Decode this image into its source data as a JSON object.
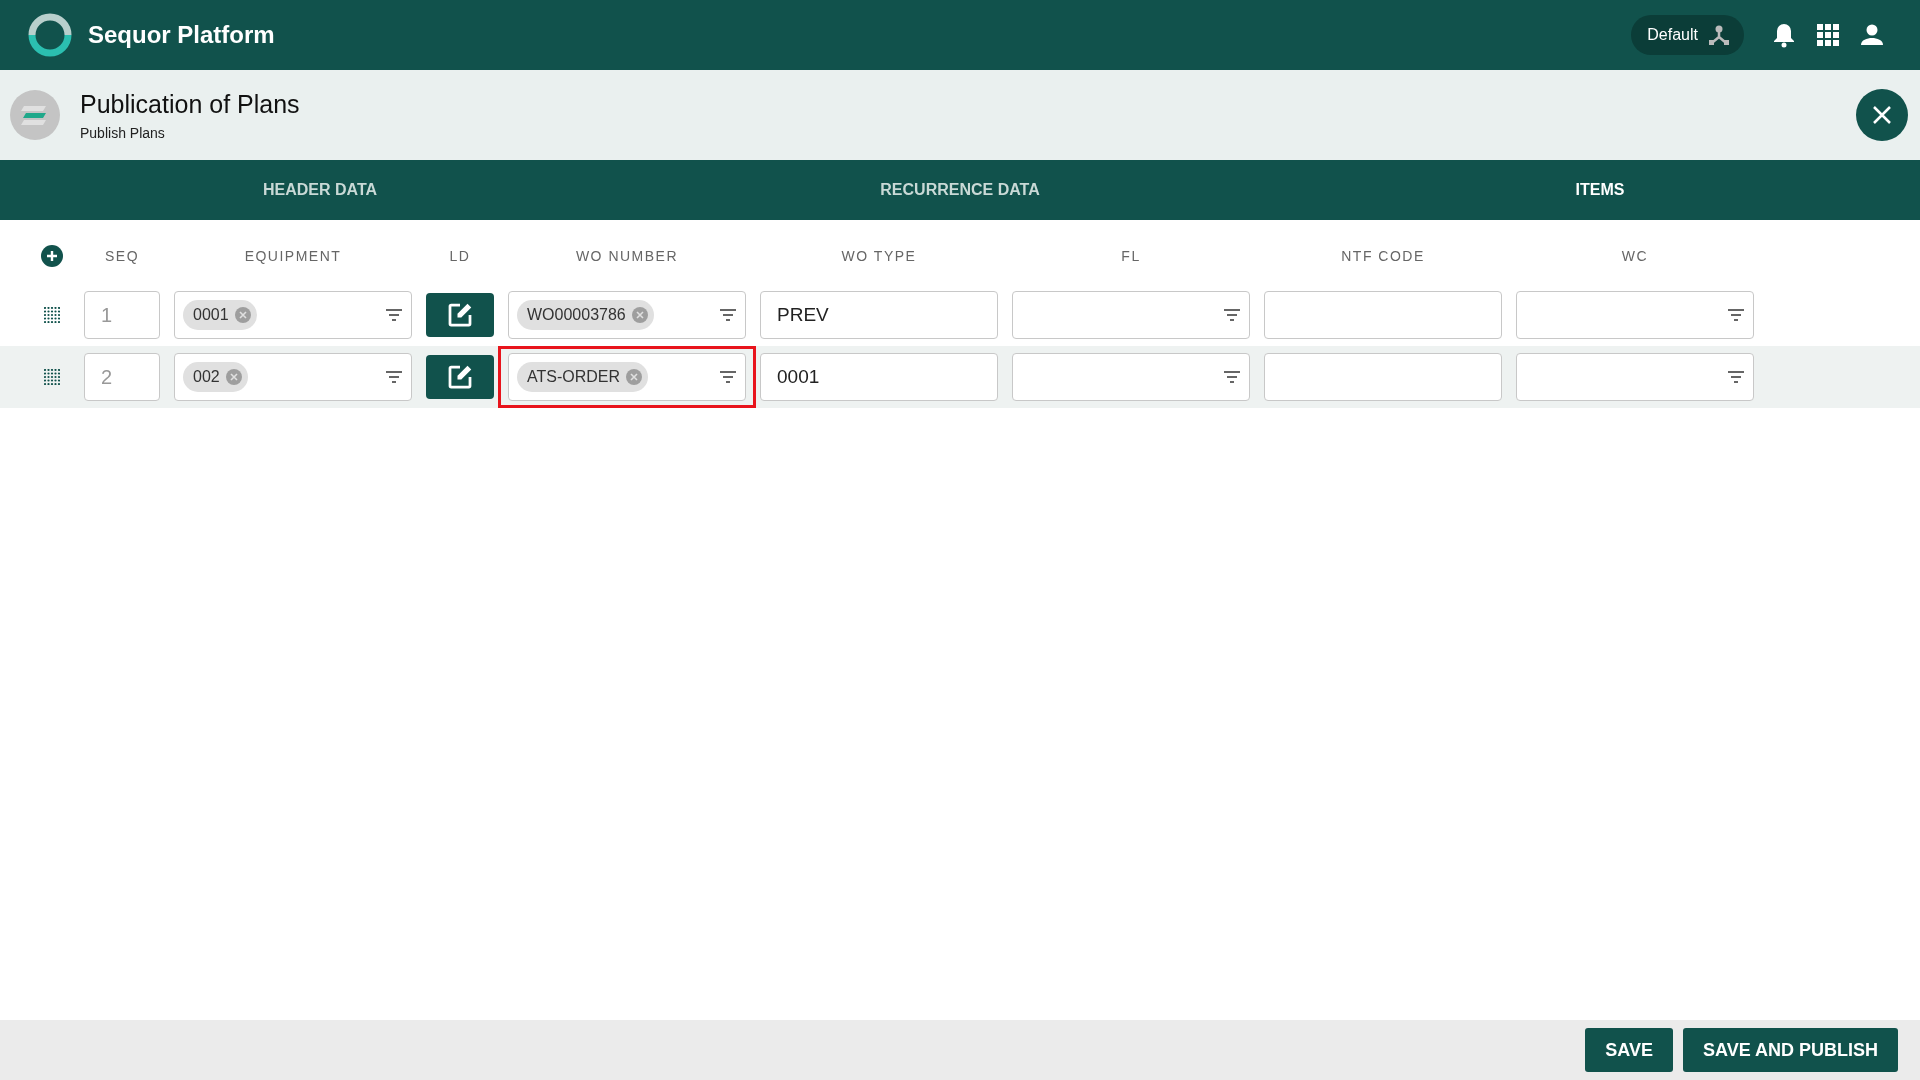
{
  "app": {
    "title": "Sequor Platform",
    "profile": "Default"
  },
  "page": {
    "title": "Publication of Plans",
    "subtitle": "Publish Plans"
  },
  "tabs": [
    {
      "label": "HEADER DATA",
      "selected": false
    },
    {
      "label": "RECURRENCE DATA",
      "selected": false
    },
    {
      "label": "ITEMS",
      "selected": true
    }
  ],
  "columns": [
    "SEQ",
    "EQUIPMENT",
    "LD",
    "WO NUMBER",
    "WO TYPE",
    "FL",
    "NTF CODE",
    "WC"
  ],
  "rows": [
    {
      "selected": false,
      "cells": [
        {
          "kind": "number",
          "value": "1"
        },
        {
          "kind": "chips",
          "chips": [
            "0001"
          ]
        },
        {
          "kind": "edit"
        },
        {
          "kind": "chips",
          "chips": [
            "WO00003786"
          ],
          "highlighted": false
        },
        {
          "kind": "text",
          "value": "PREV"
        },
        {
          "kind": "chips"
        },
        {
          "kind": "text"
        },
        {
          "kind": "chips"
        }
      ]
    },
    {
      "selected": true,
      "cells": [
        {
          "kind": "number",
          "value": "2"
        },
        {
          "kind": "chips",
          "chips": [
            "002"
          ]
        },
        {
          "kind": "edit"
        },
        {
          "kind": "chips",
          "chips": [
            "ATS-ORDER"
          ],
          "highlighted": true
        },
        {
          "kind": "text",
          "value": "0001"
        },
        {
          "kind": "chips"
        },
        {
          "kind": "text"
        },
        {
          "kind": "chips"
        }
      ]
    }
  ],
  "footer": [
    "SAVE",
    "SAVE AND PUBLISH"
  ]
}
